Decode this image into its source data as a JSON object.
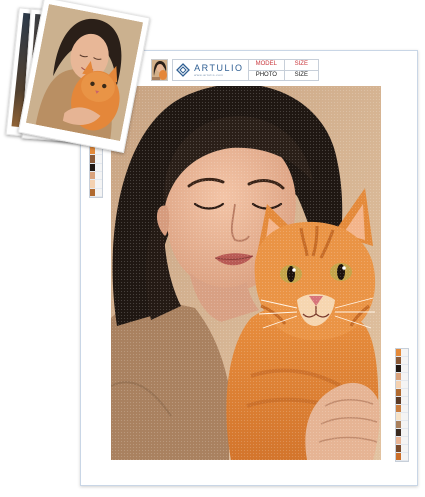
{
  "header": {
    "brand": "ARTULIO",
    "brand_sub": "www.artulio.com",
    "table": {
      "row1": [
        "MODEL",
        "SIZE"
      ],
      "row2": [
        "PHOTO",
        "SIZE"
      ]
    }
  },
  "colors": {
    "background_warm": "#d4b393",
    "hair": "#1f1712",
    "skin": "#e9b596",
    "sweater": "#a9805d",
    "cat_orange": "#e5883a",
    "cat_light": "#f4c07a",
    "brand_blue": "#2f5f93",
    "table_red": "#c9373c"
  },
  "key_colors_left": [
    "#e48a3a",
    "#8a5a38",
    "#1f1712",
    "#d9a27c",
    "#f4d1b0",
    "#b06a30"
  ],
  "key_colors_right": [
    "#e48a3a",
    "#8a5a38",
    "#1f1712",
    "#d9a27c",
    "#f4d1b0",
    "#b06a30",
    "#5a3a26",
    "#c97d3f",
    "#f7e2c6",
    "#a9805d",
    "#3a2a20",
    "#e9b596",
    "#7a4a2a",
    "#cc6f2a"
  ],
  "icons": {
    "logo": "diamond-logo-icon"
  }
}
